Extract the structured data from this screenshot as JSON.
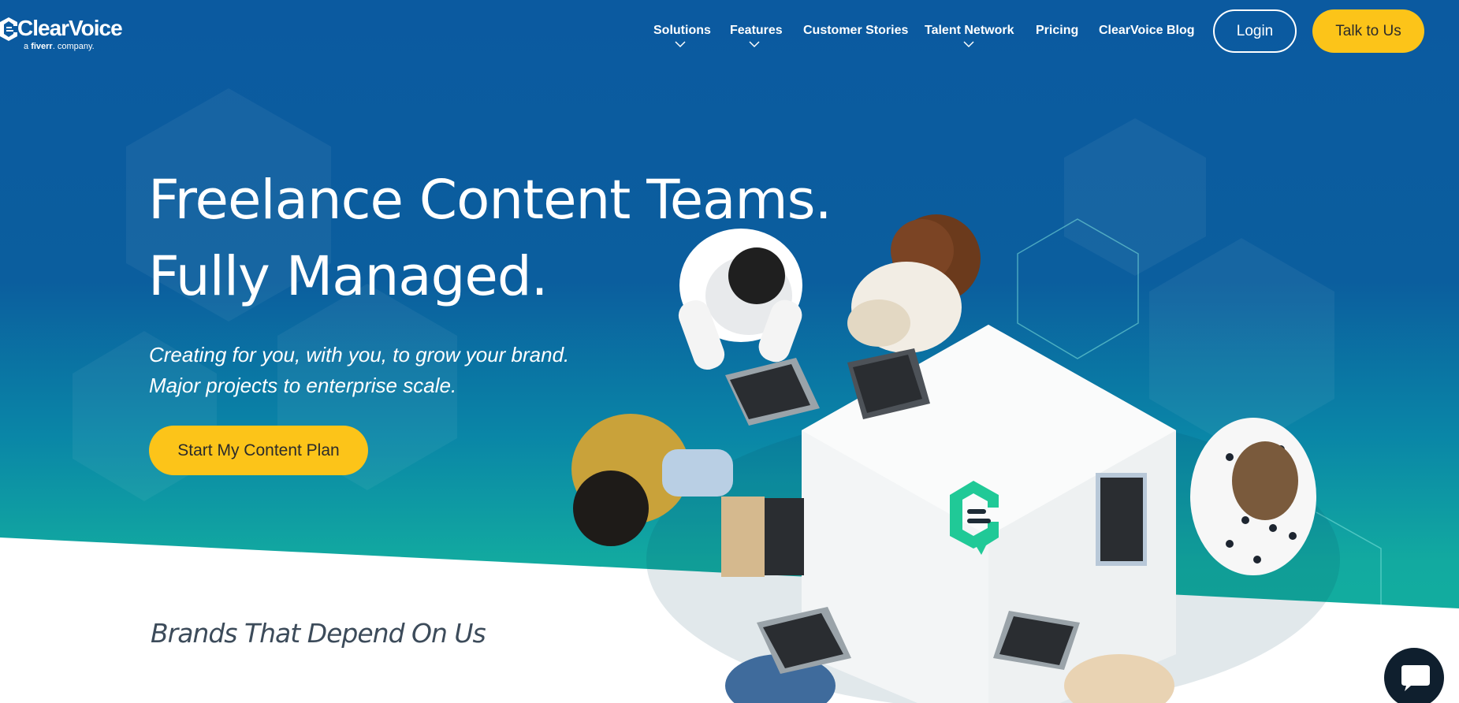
{
  "brand": {
    "name": "ClearVoice",
    "sub_prefix": "a ",
    "sub_brand": "fiverr",
    "sub_suffix": ". company."
  },
  "nav": {
    "items": [
      {
        "label": "Solutions",
        "has_dropdown": true
      },
      {
        "label": "Features",
        "has_dropdown": true
      },
      {
        "label": "Customer Stories",
        "has_dropdown": false
      },
      {
        "label": "Talent Network",
        "has_dropdown": true
      },
      {
        "label": "Pricing",
        "has_dropdown": false
      },
      {
        "label": "ClearVoice Blog",
        "has_dropdown": false
      }
    ],
    "login_label": "Login",
    "talk_label": "Talk to Us"
  },
  "hero": {
    "headline_line1": "Freelance Content Teams.",
    "headline_line2": "Fully Managed.",
    "subline_line1": "Creating for you, with you, to grow your brand.",
    "subline_line2": "Major projects to enterprise scale.",
    "cta_label": "Start My Content Plan"
  },
  "brands": {
    "title": "Brands That Depend On Us"
  },
  "colors": {
    "accent_yellow": "#fcc419",
    "brand_blue": "#0b5aa0",
    "brand_teal": "#14b39c"
  },
  "icons": {
    "chat": "chat-bubble-icon",
    "chevron": "chevron-down-icon",
    "logo": "clearvoice-logo-icon"
  }
}
